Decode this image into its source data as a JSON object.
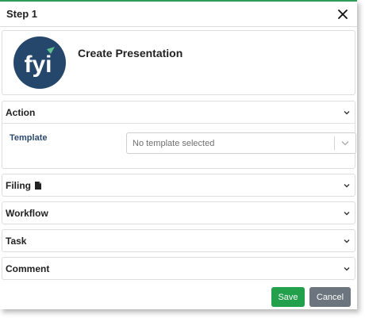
{
  "dialog": {
    "title": "Step 1",
    "close_icon": "close-icon"
  },
  "intro": {
    "logo_icon": "fyi-logo",
    "title": "Create Presentation"
  },
  "sections": {
    "action": {
      "label": "Action"
    },
    "template": {
      "label": "Template",
      "placeholder": "No template selected"
    },
    "filing": {
      "label": "Filing",
      "icon": "document-icon"
    },
    "workflow": {
      "label": "Workflow"
    },
    "task": {
      "label": "Task"
    },
    "comment": {
      "label": "Comment"
    }
  },
  "buttons": {
    "save": "Save",
    "cancel": "Cancel"
  },
  "colors": {
    "accent_border": "#2e9b57",
    "save": "#22a04b",
    "cancel": "#6c757d",
    "logo_bg": "#26476c",
    "logo_accent": "#5fbf8f",
    "field_label": "#2c4a6e"
  }
}
